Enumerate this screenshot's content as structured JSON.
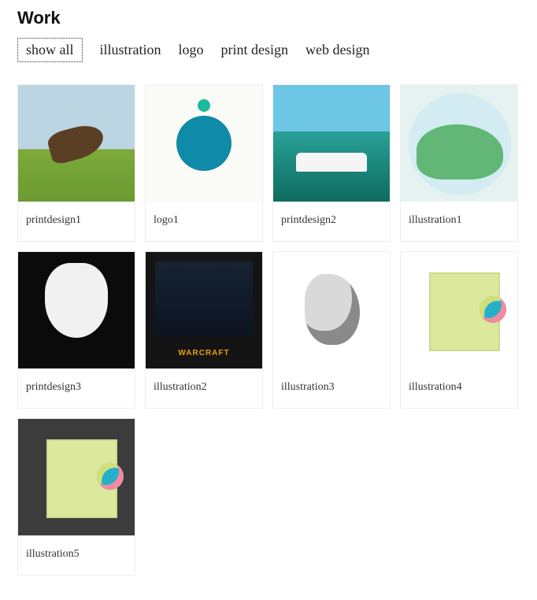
{
  "title": "Work",
  "filters": [
    {
      "label": "show all",
      "active": true
    },
    {
      "label": "illustration",
      "active": false
    },
    {
      "label": "logo",
      "active": false
    },
    {
      "label": "print design",
      "active": false
    },
    {
      "label": "web design",
      "active": false
    }
  ],
  "items": [
    {
      "title": "printdesign1",
      "thumb": "eagle"
    },
    {
      "title": "logo1",
      "thumb": "robot"
    },
    {
      "title": "printdesign2",
      "thumb": "boat"
    },
    {
      "title": "illustration1",
      "thumb": "hills"
    },
    {
      "title": "printdesign3",
      "thumb": "cat"
    },
    {
      "title": "illustration2",
      "thumb": "wow"
    },
    {
      "title": "illustration3",
      "thumb": "ink"
    },
    {
      "title": "illustration4",
      "thumb": "webL"
    },
    {
      "title": "illustration5",
      "thumb": "webD"
    }
  ]
}
